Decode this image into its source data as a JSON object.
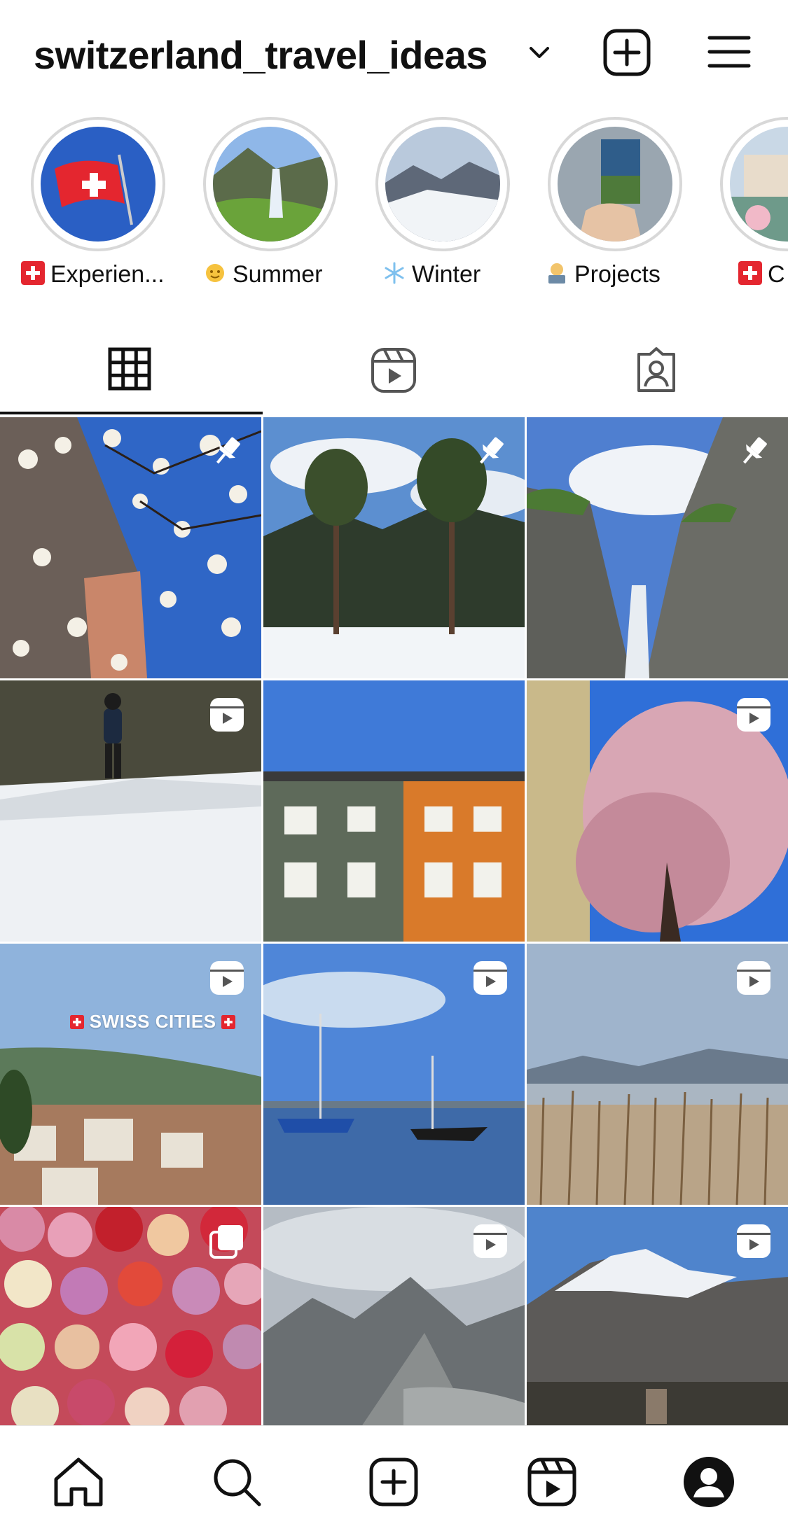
{
  "header": {
    "username": "switzerland_travel_ideas",
    "icons": [
      "chevron-down-icon",
      "create-post-icon",
      "menu-icon"
    ]
  },
  "highlights": [
    {
      "label": "Experien...",
      "emoji": "swiss-flag"
    },
    {
      "label": "Summer",
      "emoji": "sun"
    },
    {
      "label": "Winter",
      "emoji": "snowflake"
    },
    {
      "label": "Projects",
      "emoji": "person-at-laptop"
    },
    {
      "label": "C",
      "emoji": "swiss-flag"
    }
  ],
  "tabs": [
    {
      "name": "posts",
      "icon": "grid-icon",
      "active": true
    },
    {
      "name": "reels",
      "icon": "reels-icon",
      "active": false
    },
    {
      "name": "tagged",
      "icon": "tagged-icon",
      "active": false
    }
  ],
  "posts": [
    {
      "subject": "blossoms",
      "badge": "pin"
    },
    {
      "subject": "pine-trees",
      "badge": "pin"
    },
    {
      "subject": "waterfall-gorge",
      "badge": "pin"
    },
    {
      "subject": "snow-hiker",
      "badge": "reel"
    },
    {
      "subject": "buildings",
      "badge": "none"
    },
    {
      "subject": "pink-tree",
      "badge": "reel"
    },
    {
      "subject": "swiss-cities",
      "badge": "reel",
      "overlay_text": "SWISS CITIES"
    },
    {
      "subject": "lake-boats",
      "badge": "reel"
    },
    {
      "subject": "reeds-lake",
      "badge": "reel"
    },
    {
      "subject": "roses",
      "badge": "multi"
    },
    {
      "subject": "glacier",
      "badge": "reel"
    },
    {
      "subject": "snowy-mountain",
      "badge": "reel"
    }
  ],
  "bottom_nav": [
    "home-icon",
    "search-icon",
    "create-icon",
    "reels-icon",
    "profile-icon"
  ],
  "colors": {
    "text": "#111111",
    "divider": "#e6e6e6",
    "swiss_red": "#e4262f"
  }
}
